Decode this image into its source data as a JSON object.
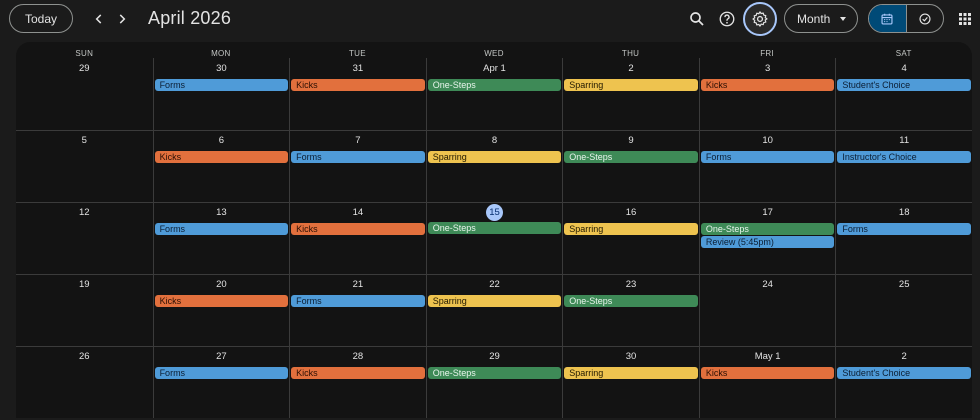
{
  "header": {
    "today_label": "Today",
    "title": "April 2026",
    "view_label": "Month"
  },
  "colors": {
    "Forms": "blue",
    "Kicks": "red",
    "One-Steps": "green",
    "Sparring": "yellow",
    "Student's Choice": "blue",
    "Instructor's Choice": "blue",
    "Review (5:45pm)": "blue"
  },
  "weekdays": [
    "SUN",
    "MON",
    "TUE",
    "WED",
    "THU",
    "FRI",
    "SAT"
  ],
  "weeks": [
    [
      {
        "day": "29",
        "events": []
      },
      {
        "day": "30",
        "events": [
          "Forms"
        ]
      },
      {
        "day": "31",
        "events": [
          "Kicks"
        ]
      },
      {
        "day": "Apr 1",
        "events": [
          "One-Steps"
        ]
      },
      {
        "day": "2",
        "events": [
          "Sparring"
        ]
      },
      {
        "day": "3",
        "events": [
          "Kicks"
        ]
      },
      {
        "day": "4",
        "events": [
          "Student's Choice"
        ]
      }
    ],
    [
      {
        "day": "5",
        "events": []
      },
      {
        "day": "6",
        "events": [
          "Kicks"
        ]
      },
      {
        "day": "7",
        "events": [
          "Forms"
        ]
      },
      {
        "day": "8",
        "events": [
          "Sparring"
        ]
      },
      {
        "day": "9",
        "events": [
          "One-Steps"
        ]
      },
      {
        "day": "10",
        "events": [
          "Forms"
        ]
      },
      {
        "day": "11",
        "events": [
          "Instructor's Choice"
        ]
      }
    ],
    [
      {
        "day": "12",
        "events": []
      },
      {
        "day": "13",
        "events": [
          "Forms"
        ]
      },
      {
        "day": "14",
        "events": [
          "Kicks"
        ]
      },
      {
        "day": "15",
        "events": [
          "One-Steps"
        ],
        "today": true
      },
      {
        "day": "16",
        "events": [
          "Sparring"
        ]
      },
      {
        "day": "17",
        "events": [
          "One-Steps",
          "Review (5:45pm)"
        ]
      },
      {
        "day": "18",
        "events": [
          "Forms"
        ]
      }
    ],
    [
      {
        "day": "19",
        "events": []
      },
      {
        "day": "20",
        "events": [
          "Kicks"
        ]
      },
      {
        "day": "21",
        "events": [
          "Forms"
        ]
      },
      {
        "day": "22",
        "events": [
          "Sparring"
        ]
      },
      {
        "day": "23",
        "events": [
          "One-Steps"
        ]
      },
      {
        "day": "24",
        "events": []
      },
      {
        "day": "25",
        "events": []
      }
    ],
    [
      {
        "day": "26",
        "events": []
      },
      {
        "day": "27",
        "events": [
          "Forms"
        ]
      },
      {
        "day": "28",
        "events": [
          "Kicks"
        ]
      },
      {
        "day": "29",
        "events": [
          "One-Steps"
        ]
      },
      {
        "day": "30",
        "events": [
          "Sparring"
        ]
      },
      {
        "day": "May 1",
        "events": [
          "Kicks"
        ]
      },
      {
        "day": "2",
        "events": [
          "Student's Choice"
        ]
      }
    ]
  ]
}
